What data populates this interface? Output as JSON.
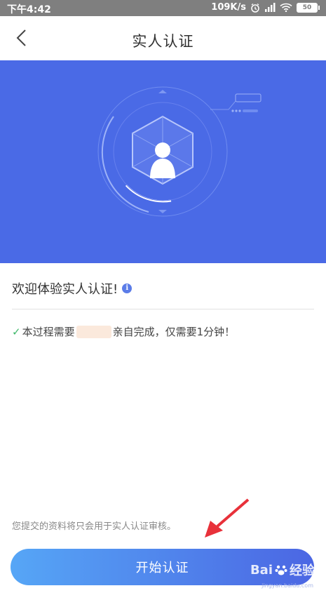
{
  "status_bar": {
    "time": "下午4:42",
    "network_speed": "109K/s",
    "icons": [
      "alarm-icon",
      "signal-icon",
      "wifi-icon"
    ],
    "battery": "50"
  },
  "nav": {
    "back_icon": "chevron-left-icon",
    "title": "实人认证"
  },
  "hero": {
    "illustration": "face-verification-icon",
    "background_color": "#4a6ae6"
  },
  "welcome": {
    "text": "欢迎体验实人认证!",
    "info_icon": "i"
  },
  "notice": {
    "prefix": "本过程需要",
    "suffix": "亲自完成，仅需要1分钟！"
  },
  "footnote": "您提交的资料将只会用于实人认证审核。",
  "start_button": "开始认证",
  "watermark": {
    "text": "Bai",
    "text2": "经验",
    "sub": "jingyan.baidu.com"
  },
  "colors": {
    "accent_start": "#56a6f6",
    "accent_end": "#4b66e3",
    "check": "#3fb86a",
    "annotation_arrow": "#e8313a"
  }
}
